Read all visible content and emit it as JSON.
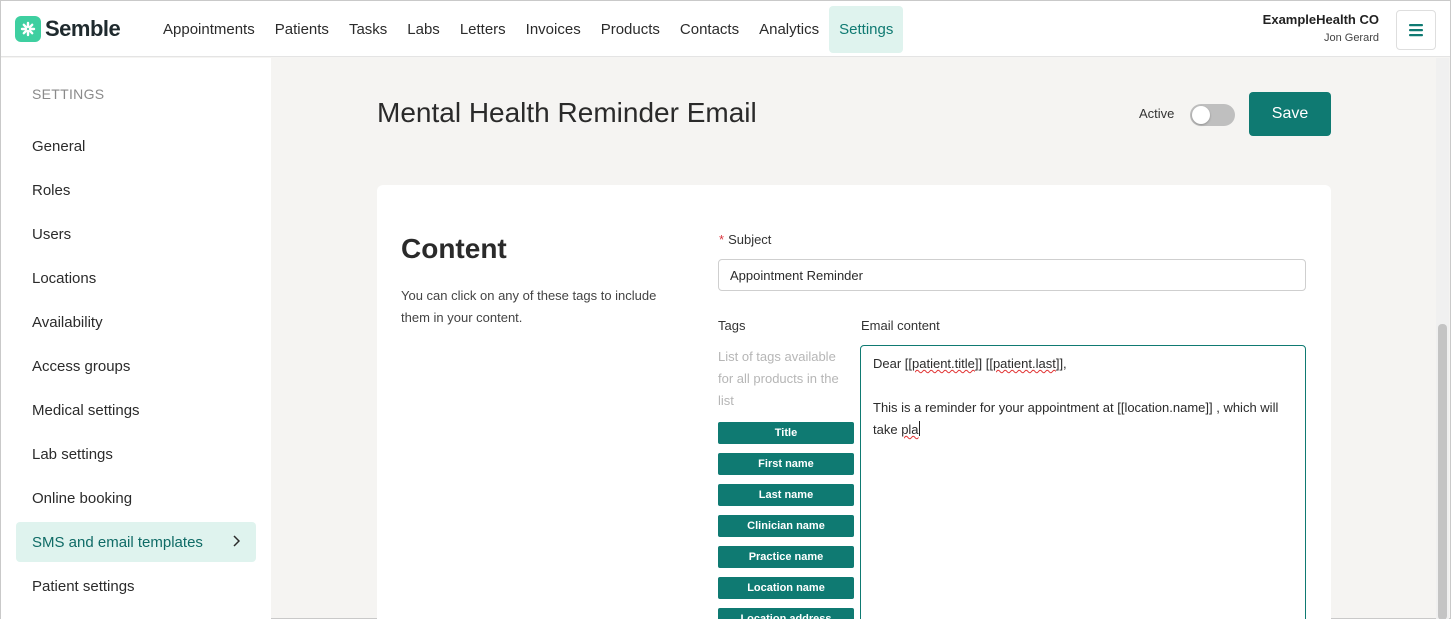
{
  "app": {
    "brand": "Semble",
    "colors": {
      "accent": "#0f7a72",
      "accent_light": "#dff3ee",
      "logo": "#3ecfa0"
    }
  },
  "nav": {
    "items": [
      "Appointments",
      "Patients",
      "Tasks",
      "Labs",
      "Letters",
      "Invoices",
      "Products",
      "Contacts",
      "Analytics",
      "Settings"
    ],
    "active": "Settings"
  },
  "account": {
    "org": "ExampleHealth CO",
    "user": "Jon Gerard",
    "menu_icon": "hamburger-icon"
  },
  "sidebar": {
    "heading": "SETTINGS",
    "items": [
      {
        "label": "General"
      },
      {
        "label": "Roles"
      },
      {
        "label": "Users"
      },
      {
        "label": "Locations"
      },
      {
        "label": "Availability"
      },
      {
        "label": "Access groups"
      },
      {
        "label": "Medical settings"
      },
      {
        "label": "Lab settings"
      },
      {
        "label": "Online booking"
      },
      {
        "label": "SMS and email templates",
        "active": true,
        "icon": "chevron-right-icon"
      },
      {
        "label": "Patient settings"
      }
    ]
  },
  "header": {
    "title": "Mental Health Reminder Email",
    "active_label": "Active",
    "active_on": false,
    "save_label": "Save"
  },
  "content": {
    "title": "Content",
    "description": "You can click on any of these tags to include them in your content.",
    "subject_label": "Subject",
    "subject_required": "*",
    "subject_value": "Appointment Reminder",
    "tags_label": "Tags",
    "tags_hint": "List of tags available for all products in the list",
    "tags": [
      "Title",
      "First name",
      "Last name",
      "Clinician name",
      "Practice name",
      "Location name",
      "Location address"
    ],
    "email_label": "Email content",
    "email_lines": {
      "line1_a": "Dear [[",
      "line1_b": "patient.title",
      "line1_c": "]] [[",
      "line1_d": "patient.last",
      "line1_e": "]],",
      "line2": "This is a reminder for your appointment at [[location.name]] , which will take ",
      "line2_typed": "pla"
    }
  }
}
